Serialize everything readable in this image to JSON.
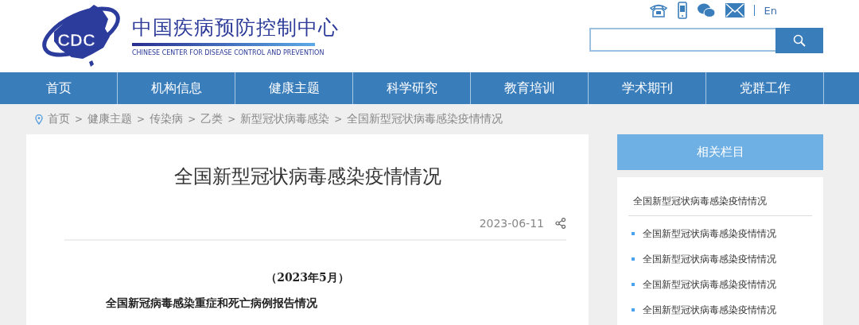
{
  "site": {
    "logo_text": "CDC",
    "name": "中国疾病预防控制中心",
    "name_en": "CHINESE CENTER FOR DISEASE CONTROL AND PREVENTION"
  },
  "top_links": {
    "language": "En"
  },
  "nav": [
    {
      "label": "首页"
    },
    {
      "label": "机构信息"
    },
    {
      "label": "健康主题"
    },
    {
      "label": "科学研究"
    },
    {
      "label": "教育培训"
    },
    {
      "label": "学术期刊"
    },
    {
      "label": "党群工作"
    }
  ],
  "breadcrumb": [
    {
      "label": "首页"
    },
    {
      "separator": ">",
      "label": "健康主题"
    },
    {
      "separator": ">",
      "label": "传染病"
    },
    {
      "separator": ">",
      "label": "乙类"
    },
    {
      "separator": ">",
      "label": "新型冠状病毒感染"
    },
    {
      "separator": ">",
      "label": "全国新型冠状病毒感染疫情情况"
    }
  ],
  "article": {
    "title": "全国新型冠状病毒感染疫情情况",
    "date": "2023-06-11",
    "subtitle": "（2023年5月）",
    "section_heading": "全国新冠病毒感染重症和死亡病例报告情况"
  },
  "sidebar": {
    "title": "相关栏目",
    "current": "全国新型冠状病毒感染疫情情况",
    "items": [
      "全国新型冠状病毒感染疫情情况",
      "全国新型冠状病毒感染疫情情况",
      "全国新型冠状病毒感染疫情情况",
      "全国新型冠状病毒感染疫情情况"
    ]
  }
}
